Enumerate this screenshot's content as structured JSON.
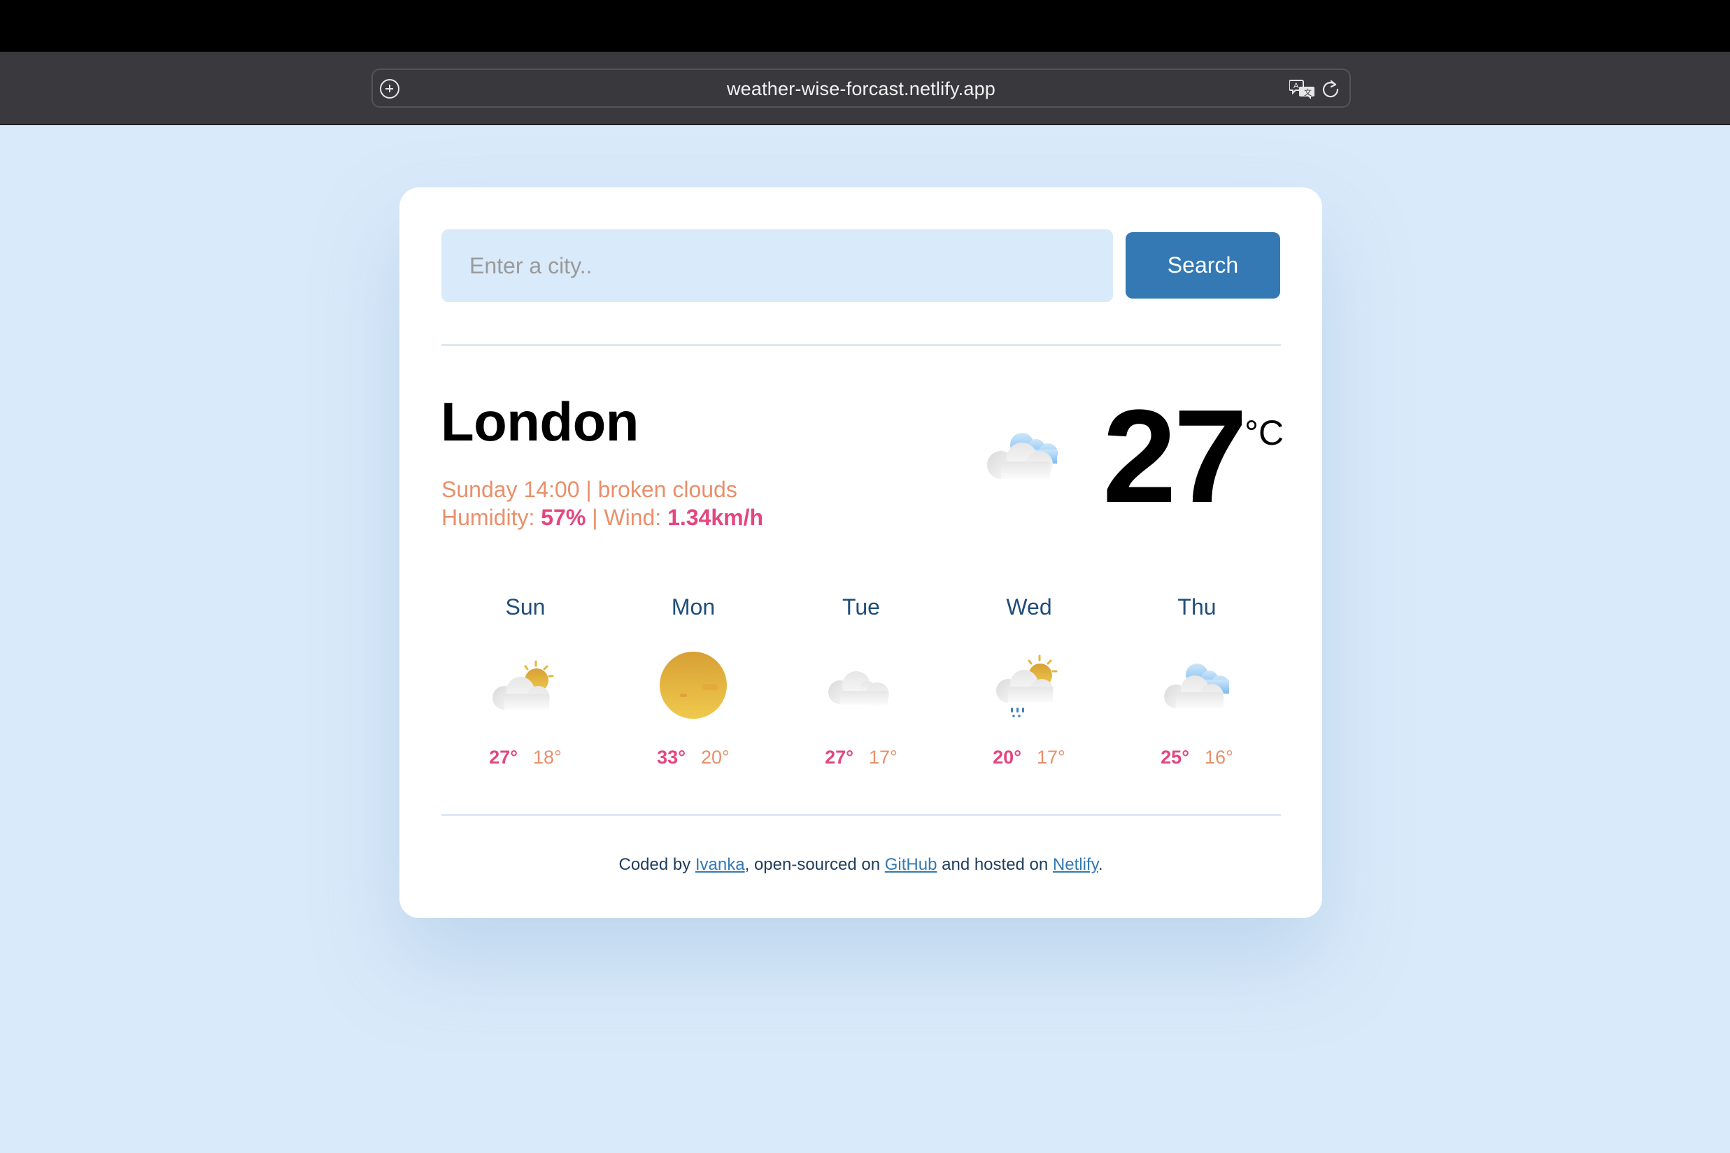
{
  "browser": {
    "url": "weather-wise-forcast.netlify.app",
    "icons": [
      "add-tab-icon",
      "translate-icon",
      "reload-icon"
    ]
  },
  "search": {
    "placeholder": "Enter a city..",
    "value": "",
    "button_label": "Search"
  },
  "current": {
    "city": "London",
    "day_time": "Sunday 14:00",
    "separator": " | ",
    "description": "broken clouds",
    "humidity_label": "Humidity: ",
    "humidity_value": "57%",
    "wind_label": "Wind: ",
    "wind_value": "1.34km/h",
    "temperature": "27",
    "unit": "°C",
    "icon": "broken-clouds-icon"
  },
  "forecast": [
    {
      "day": "Sun",
      "icon": "partly-cloudy-icon",
      "max": "27°",
      "min": "18°"
    },
    {
      "day": "Mon",
      "icon": "sun-icon",
      "max": "33°",
      "min": "20°"
    },
    {
      "day": "Tue",
      "icon": "cloud-icon",
      "max": "27°",
      "min": "17°"
    },
    {
      "day": "Wed",
      "icon": "sun-rain-icon",
      "max": "20°",
      "min": "17°"
    },
    {
      "day": "Thu",
      "icon": "broken-clouds-icon",
      "max": "25°",
      "min": "16°"
    }
  ],
  "footer": {
    "prefix": "Coded by ",
    "author_link": "Ivanka",
    "middle": ", open-sourced on ",
    "github_link": "GitHub",
    "middle2": " and hosted on ",
    "netlify_link": "Netlify",
    "suffix": "."
  },
  "colors": {
    "background": "#d9eafa",
    "accent": "#3479b3",
    "highlight": "#e4467f",
    "secondary_text": "#e98f6a",
    "day_label": "#1f4e7a"
  }
}
